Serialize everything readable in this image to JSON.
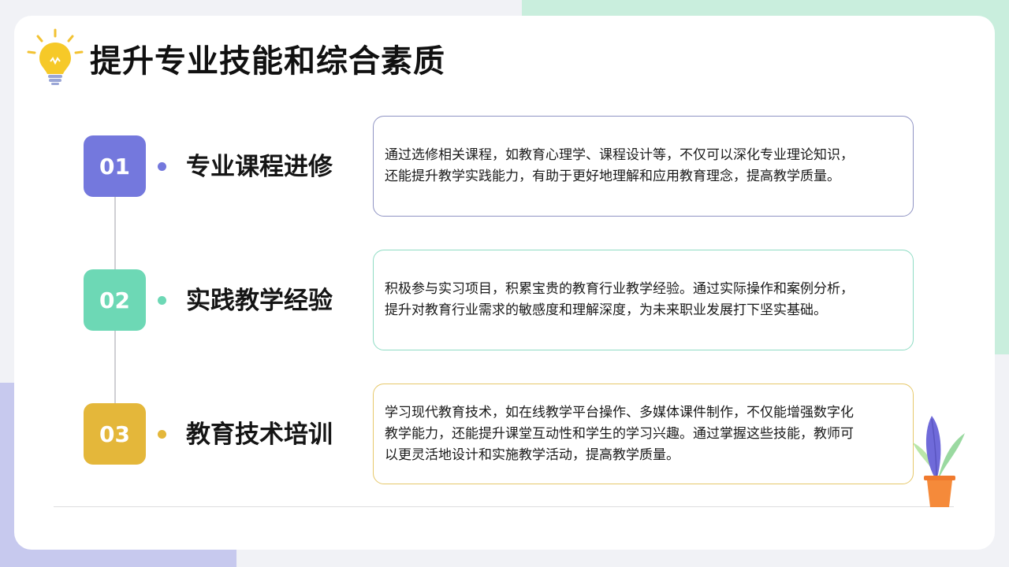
{
  "title": "提升专业技能和综合素质",
  "colors": {
    "item1": "#7478dd",
    "item2": "#6dd8b5",
    "item3": "#e4b73a",
    "box1_border": "#8f93c3",
    "box2_border": "#8fdcc4",
    "box3_border": "#e6c86a"
  },
  "icons": {
    "header": "lightbulb-icon",
    "decoration": "potted-plant-icon"
  },
  "items": [
    {
      "number": "01",
      "title": "专业课程进修",
      "description": "通过选修相关课程，如教育心理学、课程设计等，不仅可以深化专业理论知识，\n还能提升教学实践能力，有助于更好地理解和应用教育理念，提高教学质量。"
    },
    {
      "number": "02",
      "title": "实践教学经验",
      "description": "积极参与实习项目，积累宝贵的教育行业教学经验。通过实际操作和案例分析，\n提升对教育行业需求的敏感度和理解深度，为未来职业发展打下坚实基础。"
    },
    {
      "number": "03",
      "title": "教育技术培训",
      "description": "学习现代教育技术，如在线教学平台操作、多媒体课件制作，不仅能增强数字化\n教学能力，还能提升课堂互动性和学生的学习兴趣。通过掌握这些技能，教师可\n以更灵活地设计和实施教学活动，提高教学质量。"
    }
  ]
}
